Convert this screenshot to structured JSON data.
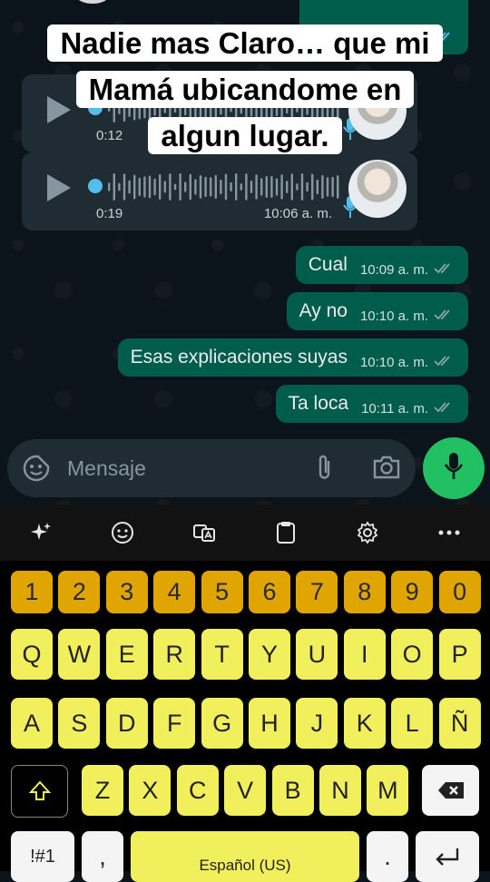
{
  "caption": {
    "line1": "Nadie mas Claro… que mi",
    "line2": "Mamá ubicandome en",
    "line3": "algun lugar."
  },
  "voice_notes": [
    {
      "duration": "0:12",
      "time": ""
    },
    {
      "duration": "0:19",
      "time": "10:06 a. m."
    }
  ],
  "messages": [
    {
      "text": "Cual",
      "time": "10:09 a. m."
    },
    {
      "text": "Ay no",
      "time": "10:10 a. m."
    },
    {
      "text": "Esas explicaciones suyas",
      "time": "10:10 a. m."
    },
    {
      "text": "Ta loca",
      "time": "10:11 a. m."
    }
  ],
  "input": {
    "placeholder": "Mensaje"
  },
  "keyboard": {
    "numbers": [
      "1",
      "2",
      "3",
      "4",
      "5",
      "6",
      "7",
      "8",
      "9",
      "0"
    ],
    "row1": [
      "Q",
      "W",
      "E",
      "R",
      "T",
      "Y",
      "U",
      "I",
      "O",
      "P"
    ],
    "row2": [
      "A",
      "S",
      "D",
      "F",
      "G",
      "H",
      "J",
      "K",
      "L",
      "Ñ"
    ],
    "row3": [
      "Z",
      "X",
      "C",
      "V",
      "B",
      "N",
      "M"
    ],
    "symbols_label": "!#1",
    "comma": ",",
    "space_label": "Español (US)",
    "period": "."
  },
  "colors": {
    "outgoing_bubble": "#005c4b",
    "incoming_bubble": "#202c33",
    "mic_fab": "#21c063",
    "key_letter": "#f2ef5d",
    "key_number": "#e0a500"
  }
}
